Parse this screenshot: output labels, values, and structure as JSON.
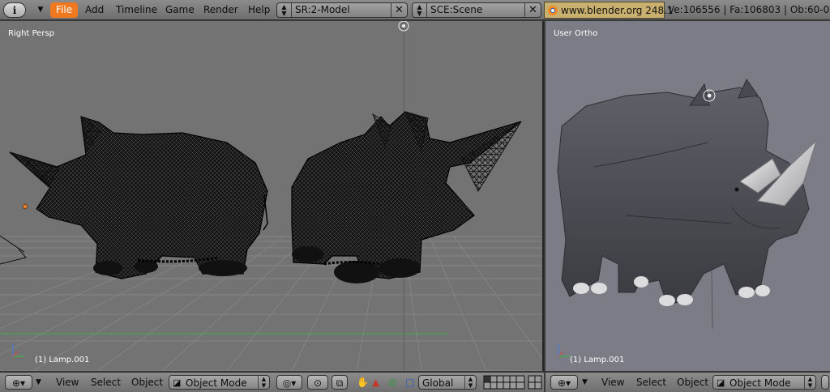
{
  "top_bar": {
    "info_icon": "info-icon",
    "menus": [
      "File",
      "Add",
      "Timeline",
      "Game",
      "Render",
      "Help"
    ],
    "screen_layout": "SR:2-Model",
    "scene": "SCE:Scene",
    "url": "www.blender.org 248.1",
    "stats": "Ve:106556 | Fa:106803 | Ob:60-0",
    "accent_color": "#f0781e"
  },
  "viewport_left": {
    "label": "Right Persp",
    "object": "(1) Lamp.001",
    "shading": "wireframe"
  },
  "viewport_right": {
    "label": "User Ortho",
    "object": "(1) Lamp.001",
    "shading": "solid"
  },
  "header_left": {
    "menus": [
      "View",
      "Select",
      "Object"
    ],
    "mode": "Object Mode",
    "orientation": "Global",
    "icons": [
      "view-type-icon",
      "collapse-icon",
      "mode-icon",
      "draw-type-icon",
      "pivot-icon",
      "hand-cursor-icon",
      "translate-icon",
      "rotate-icon",
      "scale-icon",
      "layers-icon"
    ]
  },
  "header_right": {
    "menus": [
      "View",
      "Select",
      "Object"
    ],
    "mode": "Object Mode"
  }
}
